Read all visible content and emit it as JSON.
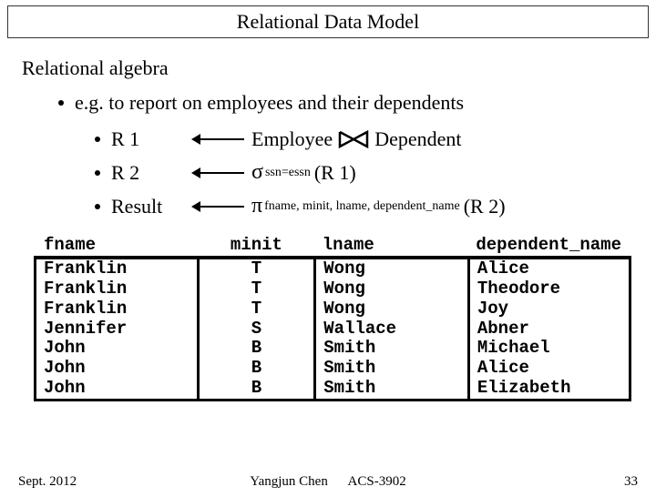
{
  "header": "Relational Data Model",
  "section": "Relational algebra",
  "main_bullet": "e.g. to report on employees and their dependents",
  "lines": {
    "r1": {
      "label": "R 1",
      "left": "Employee",
      "right": "Dependent"
    },
    "r2": {
      "label": "R 2",
      "sub": "ssn=essn",
      "arg": "(R 1)"
    },
    "result": {
      "label": "Result",
      "sub": "fname, minit, lname, dependent_name",
      "arg": "(R 2)"
    }
  },
  "table": {
    "headers": {
      "fname": "fname",
      "minit": "minit",
      "lname": "lname",
      "dep": "dependent_name"
    },
    "rows": [
      {
        "fname": "Franklin",
        "minit": "T",
        "lname": "Wong",
        "dep": "Alice"
      },
      {
        "fname": "Franklin",
        "minit": "T",
        "lname": "Wong",
        "dep": "Theodore"
      },
      {
        "fname": "Franklin",
        "minit": "T",
        "lname": "Wong",
        "dep": "Joy"
      },
      {
        "fname": "Jennifer",
        "minit": "S",
        "lname": "Wallace",
        "dep": "Abner"
      },
      {
        "fname": "John",
        "minit": "B",
        "lname": "Smith",
        "dep": "Michael"
      },
      {
        "fname": "John",
        "minit": "B",
        "lname": "Smith",
        "dep": "Alice"
      },
      {
        "fname": "John",
        "minit": "B",
        "lname": "Smith",
        "dep": "Elizabeth"
      }
    ]
  },
  "footer": {
    "left": "Sept. 2012",
    "center_author": "Yangjun Chen",
    "center_course": "ACS-3902",
    "right": "33"
  }
}
